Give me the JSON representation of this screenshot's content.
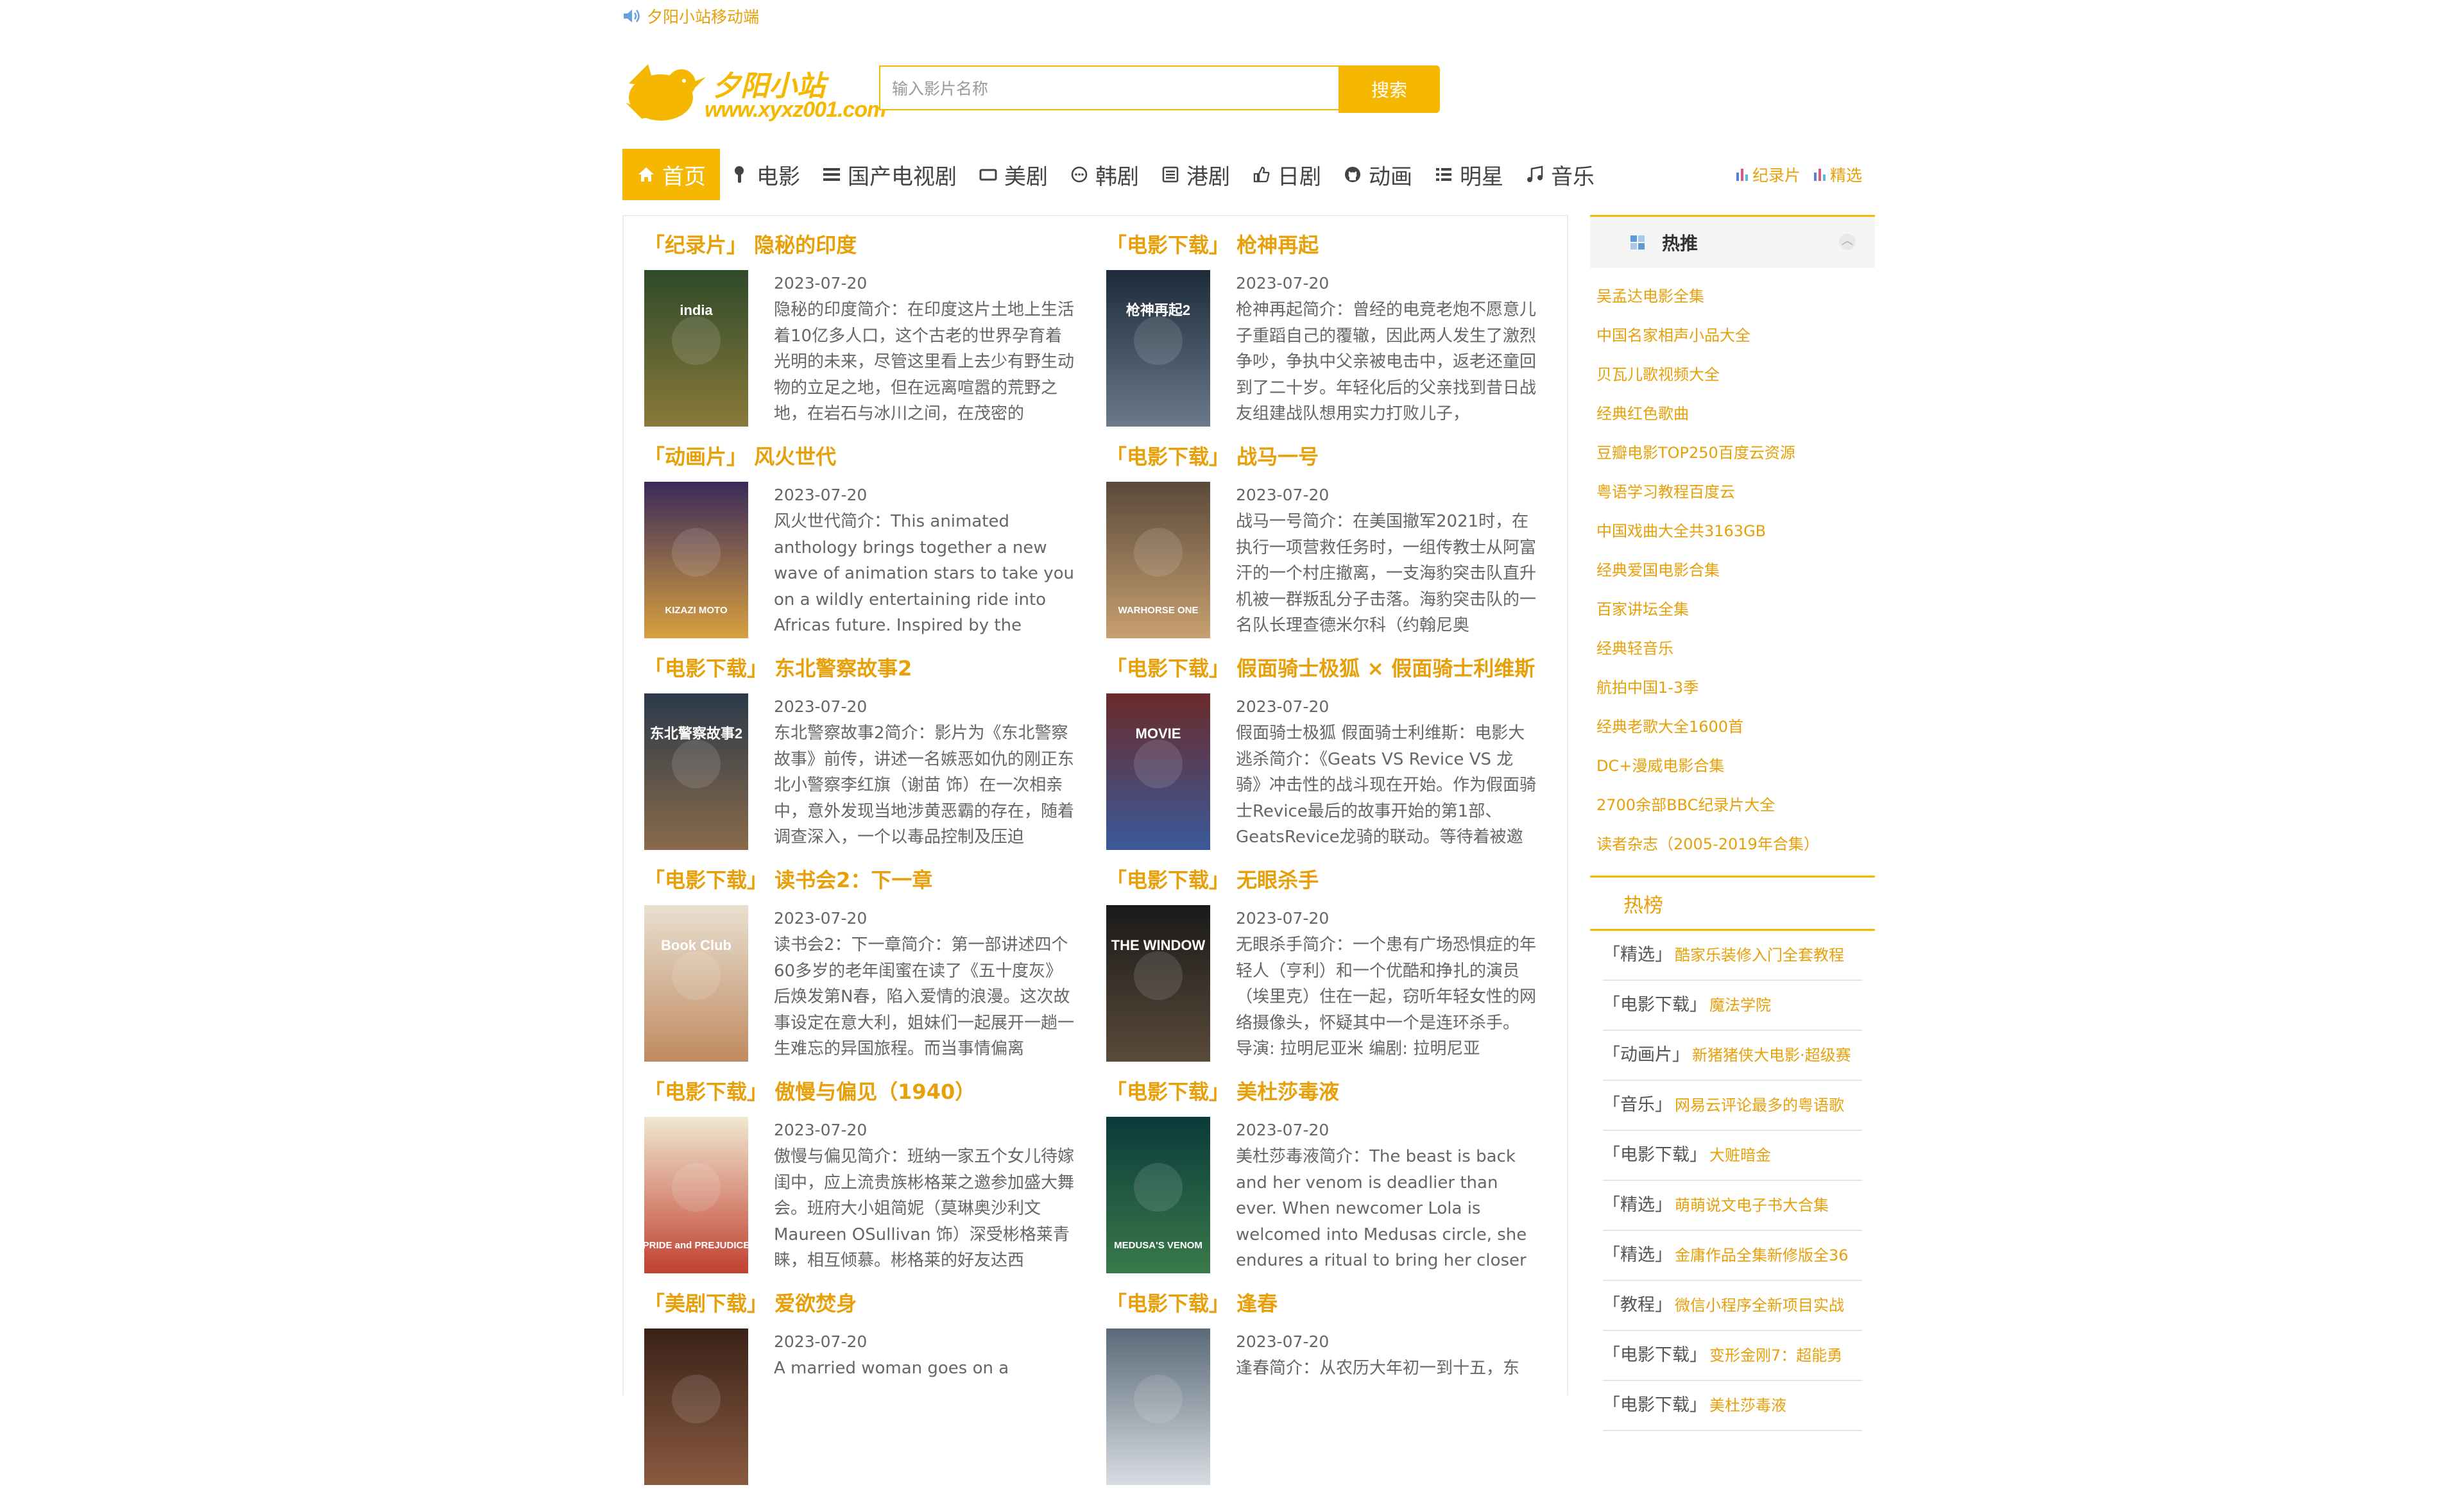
{
  "notice": {
    "text": "夕阳小站移动端",
    "icon": "speaker-icon"
  },
  "logo": {
    "title": "夕阳小站",
    "url_text": "www.xyxz001.com"
  },
  "search": {
    "placeholder": "输入影片名称",
    "button": "搜索"
  },
  "nav": {
    "items": [
      {
        "label": "首页",
        "icon": "home-icon",
        "active": true
      },
      {
        "label": "电影",
        "icon": "brush-icon"
      },
      {
        "label": "国产电视剧",
        "icon": "list-icon"
      },
      {
        "label": "美剧",
        "icon": "tv-icon"
      },
      {
        "label": "韩剧",
        "icon": "chat-icon"
      },
      {
        "label": "港剧",
        "icon": "book-icon"
      },
      {
        "label": "日剧",
        "icon": "thumbs-up-icon"
      },
      {
        "label": "动画",
        "icon": "github-icon"
      },
      {
        "label": "明星",
        "icon": "list-alt-icon"
      },
      {
        "label": "音乐",
        "icon": "music-icon"
      }
    ],
    "right": [
      {
        "label": "纪录片",
        "icon": "bar-chart-icon"
      },
      {
        "label": "精选",
        "icon": "bar-chart-icon"
      }
    ]
  },
  "posts": [
    {
      "category": "「纪录片」",
      "title": "隐秘的印度",
      "date": "2023-07-20",
      "desc": "隐秘的印度简介：在印度这片土地上生活着10亿多人口，这个古老的世界孕育着光明的未来，尽管这里看上去少有野生动物的立足之地，但在远离喧嚣的荒野之地，在岩石与冰川之间，在茂密的",
      "poster_label": "india",
      "colors": [
        "#2e4a2a",
        "#8a7a3a"
      ]
    },
    {
      "category": "「电影下载」",
      "title": "枪神再起",
      "date": "2023-07-20",
      "desc": "枪神再起简介：曾经的电竞老炮不愿意儿子重蹈自己的覆辙，因此两人发生了激烈争吵，争执中父亲被电击中，返老还童回到了二十岁。年轻化后的父亲找到昔日战友组建战队想用实力打败儿子，",
      "poster_label": "枪神再起2",
      "colors": [
        "#1d2a3a",
        "#6a7a8a"
      ]
    },
    {
      "category": "「动画片」",
      "title": "风火世代",
      "date": "2023-07-20",
      "desc": "风火世代简介：This animated anthology brings together a new wave of animation stars to take you on a wildly entertaining ride into Africas future. Inspired by the",
      "poster_label": "KIZAZI MOTO",
      "colors": [
        "#3a2a5a",
        "#d8a040"
      ]
    },
    {
      "category": "「电影下载」",
      "title": "战马一号",
      "date": "2023-07-20",
      "desc": "战马一号简介：在美国撤军2021时，在执行一项营救任务时，一组传教士从阿富汗的一个村庄撤离，一支海豹突击队直升机被一群叛乱分子击落。海豹突击队的一名队长理查德米尔科（约翰尼奥",
      "poster_label": "WARHORSE ONE",
      "colors": [
        "#5a4a3a",
        "#c8a070"
      ]
    },
    {
      "category": "「电影下载」",
      "title": "东北警察故事2",
      "date": "2023-07-20",
      "desc": "东北警察故事2简介：影片为《东北警察故事》前传，讲述一名嫉恶如仇的刚正东北小警察李红旗（谢苗 饰）在一次相亲中，意外发现当地涉黄恶霸的存在，随着调查深入，一个以毒品控制及压迫",
      "poster_label": "东北警察故事2",
      "colors": [
        "#2a3a4a",
        "#8a6a4a"
      ]
    },
    {
      "category": "「电影下载」",
      "title": "假面骑士极狐 × 假面骑士利维斯",
      "date": "2023-07-20",
      "desc": "假面骑士极狐 假面骑士利维斯：电影大逃杀简介：《Geats VS Revice VS 龙骑》冲击性的战斗现在开始。作为假面骑士Revice最后的故事开始的第1部、GeatsRevice龙骑的联动。等待着被邀",
      "poster_label": "MOVIE",
      "colors": [
        "#6a2a2a",
        "#3a5a9a"
      ]
    },
    {
      "category": "「电影下载」",
      "title": "读书会2：下一章",
      "date": "2023-07-20",
      "desc": "读书会2：下一章简介：第一部讲述四个60多岁的老年闺蜜在读了《五十度灰》后焕发第N春，陷入爱情的浪漫。这次故事设定在意大利，姐妹们一起展开一趟一生难忘的异国旅程。而当事情偏离",
      "poster_label": "Book Club",
      "colors": [
        "#e8e0d0",
        "#c08a60"
      ]
    },
    {
      "category": "「电影下载」",
      "title": "无眼杀手",
      "date": "2023-07-20",
      "desc": "无眼杀手简介：一个患有广场恐惧症的年轻人（亨利）和一个优酷和挣扎的演员（埃里克）住在一起，窃听年轻女性的网络摄像头，怀疑其中一个是连环杀手。 导演: 拉明尼亚米 编剧: 拉明尼亚",
      "poster_label": "THE WINDOW",
      "colors": [
        "#1a1a1a",
        "#5a4a3a"
      ]
    },
    {
      "category": "「电影下载」",
      "title": "傲慢与偏见（1940）",
      "date": "2023-07-20",
      "desc": "傲慢与偏见简介：班纳一家五个女儿待嫁闺中，应上流贵族彬格莱之邀参加盛大舞会。班府大小姐简妮（莫琳奥沙利文 Maureen OSullivan 饰）深受彬格莱青睐，相互倾慕。彬格莱的好友达西",
      "poster_label": "PRIDE and PREJUDICE",
      "colors": [
        "#f0e8d0",
        "#c04030"
      ]
    },
    {
      "category": "「电影下载」",
      "title": "美杜莎毒液",
      "date": "2023-07-20",
      "desc": "美杜莎毒液简介：The beast is back and her venom is deadlier than ever. When newcomer Lola is welcomed into Medusas circle, she endures a ritual to bring her closer",
      "poster_label": "MEDUSA'S VENOM",
      "colors": [
        "#0a3a3a",
        "#3a7a4a"
      ]
    },
    {
      "category": "「美剧下载」",
      "title": "爱欲焚身",
      "date": "2023-07-20",
      "desc": "A married woman goes on a",
      "poster_label": "",
      "colors": [
        "#3a2218",
        "#8a5a40"
      ]
    },
    {
      "category": "「电影下载」",
      "title": "逢春",
      "date": "2023-07-20",
      "desc": "逢春简介：从农历大年初一到十五，东",
      "poster_label": "",
      "colors": [
        "#5a6a78",
        "#d8dde2"
      ]
    }
  ],
  "sidebar": {
    "hot": {
      "title": "热推",
      "items": [
        "吴孟达电影全集",
        "中国名家相声小品大全",
        "贝瓦儿歌视频大全",
        "经典红色歌曲",
        "豆瓣电影TOP250百度云资源",
        "粤语学习教程百度云",
        "中国戏曲大全共3163GB",
        "经典爱国电影合集",
        "百家讲坛全集",
        "经典轻音乐",
        "航拍中国1-3季",
        "经典老歌大全1600首",
        "DC+漫威电影合集",
        "2700余部BBC纪录片大全",
        "读者杂志（2005-2019年合集）"
      ]
    },
    "rank": {
      "title": "热榜",
      "items": [
        {
          "cat": "「精选」",
          "name": "酷家乐装修入门全套教程"
        },
        {
          "cat": "「电影下载」",
          "name": "魔法学院"
        },
        {
          "cat": "「动画片」",
          "name": "新猪猪侠大电影·超级赛"
        },
        {
          "cat": "「音乐」",
          "name": "网易云评论最多的粤语歌"
        },
        {
          "cat": "「电影下载」",
          "name": "大赃暗金"
        },
        {
          "cat": "「精选」",
          "name": "萌萌说文电子书大合集"
        },
        {
          "cat": "「精选」",
          "name": "金庸作品全集新修版全36"
        },
        {
          "cat": "「教程」",
          "name": "微信小程序全新项目实战"
        },
        {
          "cat": "「电影下载」",
          "name": "变形金刚7：超能勇"
        },
        {
          "cat": "「电影下载」",
          "name": "美杜莎毒液"
        }
      ]
    }
  },
  "colors": {
    "accent": "#f5b700",
    "link": "#e8a00a"
  }
}
